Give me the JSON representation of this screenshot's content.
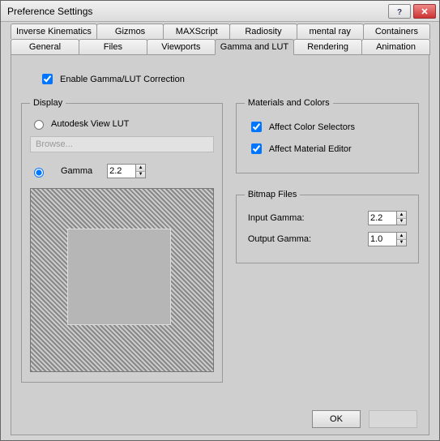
{
  "window": {
    "title": "Preference Settings"
  },
  "tabs": {
    "row1": [
      "Inverse Kinematics",
      "Gizmos",
      "MAXScript",
      "Radiosity",
      "mental ray",
      "Containers"
    ],
    "row2": [
      "General",
      "Files",
      "Viewports",
      "Gamma and LUT",
      "Rendering",
      "Animation"
    ],
    "activeIndexRow2": 3
  },
  "enableGamma": {
    "label": "Enable Gamma/LUT Correction",
    "checked": true
  },
  "display": {
    "legend": "Display",
    "autodesk": {
      "label": "Autodesk View LUT",
      "selected": false
    },
    "browse": "Browse...",
    "gamma": {
      "label": "Gamma",
      "selected": true,
      "value": "2.2"
    }
  },
  "materials": {
    "legend": "Materials and Colors",
    "affectColor": {
      "label": "Affect Color Selectors",
      "checked": true
    },
    "affectMaterial": {
      "label": "Affect Material Editor",
      "checked": true
    }
  },
  "bitmap": {
    "legend": "Bitmap Files",
    "input": {
      "label": "Input Gamma:",
      "value": "2.2"
    },
    "output": {
      "label": "Output Gamma:",
      "value": "1.0"
    }
  },
  "buttons": {
    "ok": "OK"
  }
}
